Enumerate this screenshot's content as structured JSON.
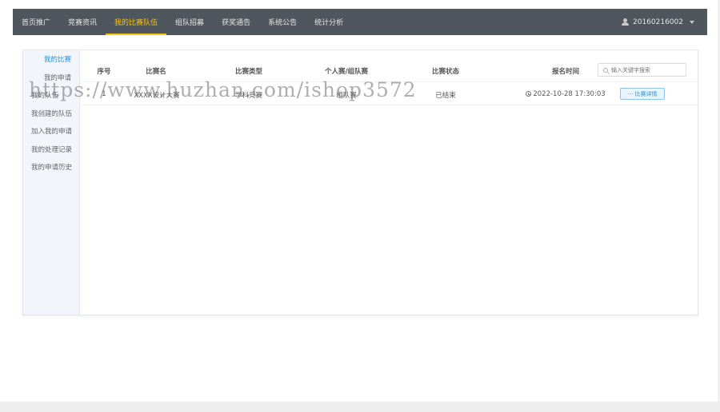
{
  "nav": {
    "items": [
      {
        "label": "首页推广",
        "active": false
      },
      {
        "label": "竞赛资讯",
        "active": false
      },
      {
        "label": "我的比赛队伍",
        "active": true
      },
      {
        "label": "组队招募",
        "active": false
      },
      {
        "label": "获奖通告",
        "active": false
      },
      {
        "label": "系统公告",
        "active": false
      },
      {
        "label": "统计分析",
        "active": false
      }
    ],
    "user": "20160216002",
    "active_color": "#f5c518",
    "bar_color": "#50565d"
  },
  "sidebar": {
    "items": [
      {
        "label": "我的比赛",
        "active": true,
        "level": "sub"
      },
      {
        "label": "我的申请",
        "active": false,
        "level": "sub"
      },
      {
        "label": "我的队伍",
        "active": false,
        "level": "top"
      },
      {
        "label": "我创建的队伍",
        "active": false,
        "level": "top"
      },
      {
        "label": "加入我的申请",
        "active": false,
        "level": "top"
      },
      {
        "label": "我的处理记录",
        "active": false,
        "level": "top"
      },
      {
        "label": "我的申请历史",
        "active": false,
        "level": "top"
      }
    ]
  },
  "table": {
    "headers": [
      "序号",
      "比赛名",
      "比赛类型",
      "个人赛/组队赛",
      "比赛状态",
      "报名时间"
    ],
    "search_placeholder": "输入关键字搜索",
    "rows": [
      {
        "index": "1",
        "name": "XXXX设计大赛",
        "type": "学科竞赛",
        "mode": "组队赛",
        "status": "已结束",
        "time": "2022-10-28 17:30:03",
        "action": "··· 比赛详情"
      }
    ]
  },
  "watermark": "https://www.huzhan.com/ishop3572",
  "accent_color": "#2a8fd6"
}
